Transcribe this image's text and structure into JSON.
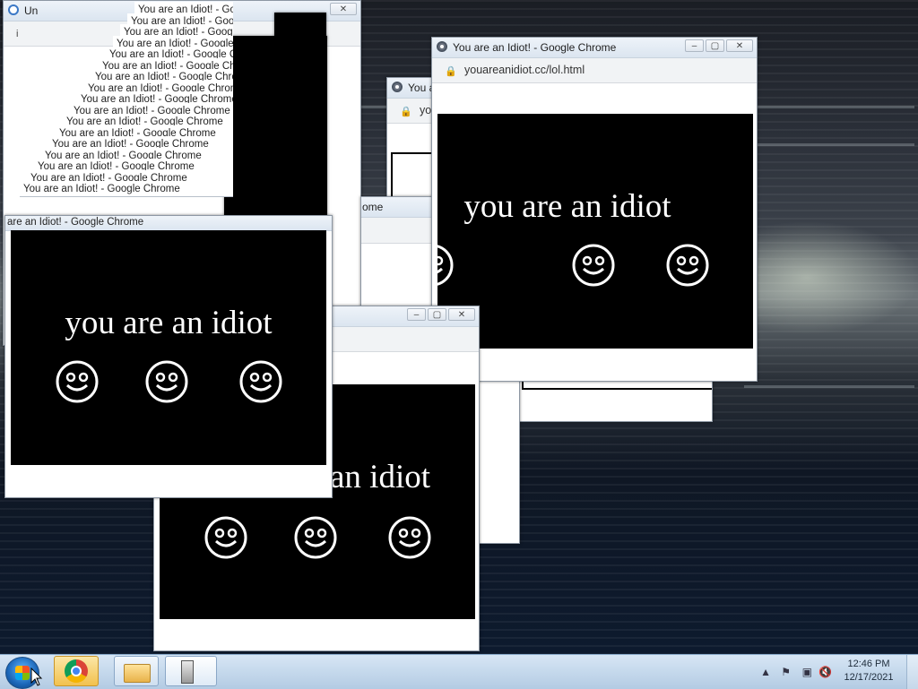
{
  "desktop": {},
  "windows": {
    "main": {
      "title": "You are an Idiot! - Google Chrome",
      "url": "youareanidiot.cc/lol.html",
      "message": "you are an idiot"
    },
    "left": {
      "title": "are an Idiot! - Google Chrome",
      "message": "you are an idiot"
    },
    "bottom": {
      "message": "an idiot"
    },
    "middle": {
      "title_fragment": "ome"
    },
    "mid_back": {
      "title_fragment": "You a",
      "url_fragment": "yo"
    },
    "top_left": {
      "title_fragment": "Un",
      "info_icon": "i"
    }
  },
  "stacked_titles": [
    "You are an Idiot! - Google Chrome",
    "You are an Idiot! - Google Chrome",
    "You are an Idiot! - Google Chrome",
    "You are an Idiot! - Google Chrome",
    "You are an Idiot! - Google Chrome",
    "You are an Idiot! - Google Chrome",
    "You are an Idiot! - Google Chrome",
    "You are an Idiot! - Google Chrome",
    "You are an Idiot! - Google Chrome",
    "You are an Idiot! - Google Chrome",
    "You are an Idiot! - Google Chrome",
    "You are an Idiot! - Google Chrome",
    "You are an Idiot! - Google Chrome",
    "You are an Idiot! - Google Chrome",
    "You are an Idiot! - Google Chrome",
    "You are an Idiot! - Google Chrome",
    "You are an Idiot! - Google Chrome"
  ],
  "window_controls": {
    "minimize": "–",
    "maximize": "▢",
    "close": "✕"
  },
  "taskbar": {
    "time": "12:46 PM",
    "date": "12/17/2021",
    "start_icon": "windows-logo",
    "pinned": [
      "chrome",
      "file-explorer",
      "task-manager"
    ],
    "tray": [
      "show-hidden-icons",
      "action-center-flag",
      "network",
      "volume-muted"
    ]
  }
}
